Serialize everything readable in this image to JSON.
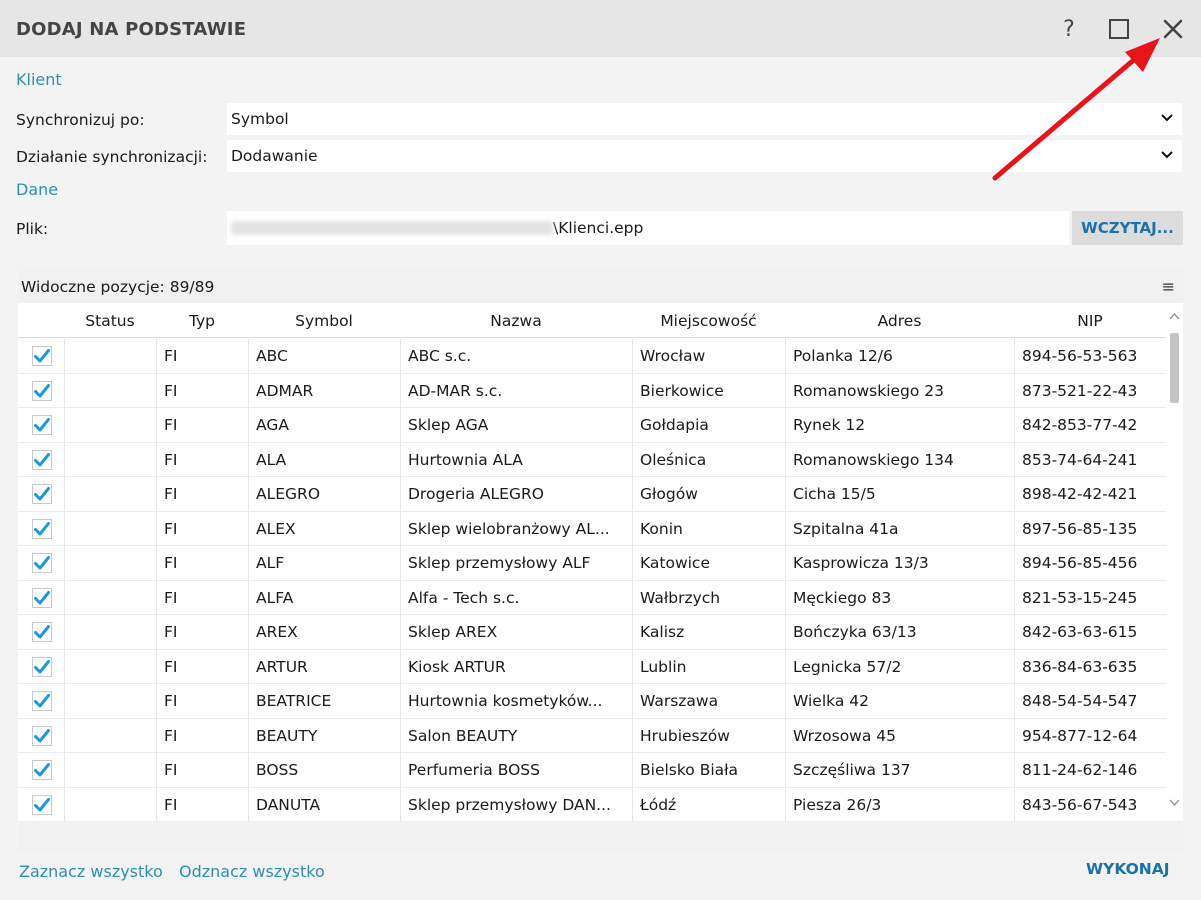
{
  "window": {
    "title": "DODAJ NA PODSTAWIE",
    "help_label": "?"
  },
  "klient": {
    "section": "Klient",
    "sync_by_label": "Synchronizuj po:",
    "sync_by_value": "Symbol",
    "sync_action_label": "Działanie synchronizacji:",
    "sync_action_value": "Dodawanie"
  },
  "dane": {
    "section": "Dane",
    "file_label": "Plik:",
    "file_value": "\\Klienci.epp",
    "load_button": "WCZYTAJ..."
  },
  "grid": {
    "visible_positions": "Widoczne pozycje: 89/89",
    "menu_icon": "≡",
    "columns": [
      "Status",
      "Typ",
      "Symbol",
      "Nazwa",
      "Miejscowość",
      "Adres",
      "NIP"
    ],
    "rows": [
      {
        "typ": "FI",
        "symbol": "ABC",
        "nazwa": "ABC s.c.",
        "miejscowosc": "Wrocław",
        "adres": "Polanka  12/6",
        "nip": "894-56-53-563"
      },
      {
        "typ": "FI",
        "symbol": "ADMAR",
        "nazwa": "AD-MAR s.c.",
        "miejscowosc": "Bierkowice",
        "adres": "Romanowskiego 23",
        "nip": "873-521-22-43"
      },
      {
        "typ": "FI",
        "symbol": "AGA",
        "nazwa": "Sklep AGA",
        "miejscowosc": "Gołdapia",
        "adres": "Rynek 12",
        "nip": "842-853-77-42"
      },
      {
        "typ": "FI",
        "symbol": "ALA",
        "nazwa": "Hurtownia ALA",
        "miejscowosc": "Oleśnica",
        "adres": "Romanowskiego 134",
        "nip": "853-74-64-241"
      },
      {
        "typ": "FI",
        "symbol": "ALEGRO",
        "nazwa": "Drogeria ALEGRO",
        "miejscowosc": "Głogów",
        "adres": "Cicha  15/5",
        "nip": "898-42-42-421"
      },
      {
        "typ": "FI",
        "symbol": "ALEX",
        "nazwa": "Sklep wielobranżowy  AL...",
        "miejscowosc": "Konin",
        "adres": "Szpitalna  41a",
        "nip": "897-56-85-135"
      },
      {
        "typ": "FI",
        "symbol": "ALF",
        "nazwa": "Sklep przemysłowy ALF",
        "miejscowosc": "Katowice",
        "adres": "Kasprowicza  13/3",
        "nip": "894-56-85-456"
      },
      {
        "typ": "FI",
        "symbol": "ALFA",
        "nazwa": "Alfa - Tech s.c.",
        "miejscowosc": "Wałbrzych",
        "adres": "Męckiego  83",
        "nip": "821-53-15-245"
      },
      {
        "typ": "FI",
        "symbol": "AREX",
        "nazwa": "Sklep AREX",
        "miejscowosc": "Kalisz",
        "adres": "Bończyka  63/13",
        "nip": "842-63-63-615"
      },
      {
        "typ": "FI",
        "symbol": "ARTUR",
        "nazwa": "Kiosk ARTUR",
        "miejscowosc": "Lublin",
        "adres": "Legnicka  57/2",
        "nip": "836-84-63-635"
      },
      {
        "typ": "FI",
        "symbol": "BEATRICE",
        "nazwa": "Hurtownia kosmetyków...",
        "miejscowosc": "Warszawa",
        "adres": "Wielka  42",
        "nip": "848-54-54-547"
      },
      {
        "typ": "FI",
        "symbol": "BEAUTY",
        "nazwa": "Salon BEAUTY",
        "miejscowosc": "Hrubieszów",
        "adres": "Wrzosowa  45",
        "nip": "954-877-12-64"
      },
      {
        "typ": "FI",
        "symbol": "BOSS",
        "nazwa": "Perfumeria BOSS",
        "miejscowosc": "Bielsko Biała",
        "adres": "Szczęśliwa  137",
        "nip": "811-24-62-146"
      },
      {
        "typ": "FI",
        "symbol": "DANUTA",
        "nazwa": "Sklep przemysłowy DAN...",
        "miejscowosc": "Łódź",
        "adres": "Piesza  26/3",
        "nip": "843-56-67-543"
      }
    ]
  },
  "footer": {
    "select_all": "Zaznacz wszystko",
    "deselect_all": "Odznacz wszystko",
    "execute": "WYKONAJ"
  },
  "colors": {
    "accent": "#2e8fb5",
    "button_text": "#1a72a8",
    "check": "#1a9ad6",
    "arrow": "#e8141b"
  }
}
